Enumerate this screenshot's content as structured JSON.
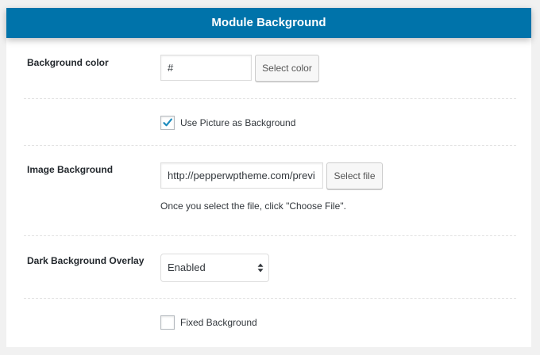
{
  "header": {
    "title": "Module Background"
  },
  "background_color": {
    "label": "Background color",
    "value": "#",
    "button": "Select color"
  },
  "use_picture": {
    "label": "Use Picture as Background",
    "checked": true
  },
  "image_background": {
    "label": "Image Background",
    "value": "http://pepperwptheme.com/previ",
    "button": "Select file",
    "hint": "Once you select the file, click \"Choose File\"."
  },
  "overlay": {
    "label": "Dark Background Overlay",
    "selected": "Enabled"
  },
  "fixed_background": {
    "label": "Fixed Background",
    "checked": false
  },
  "colors": {
    "header_bg": "#0073aa",
    "check_mark": "#1e8cbe"
  }
}
